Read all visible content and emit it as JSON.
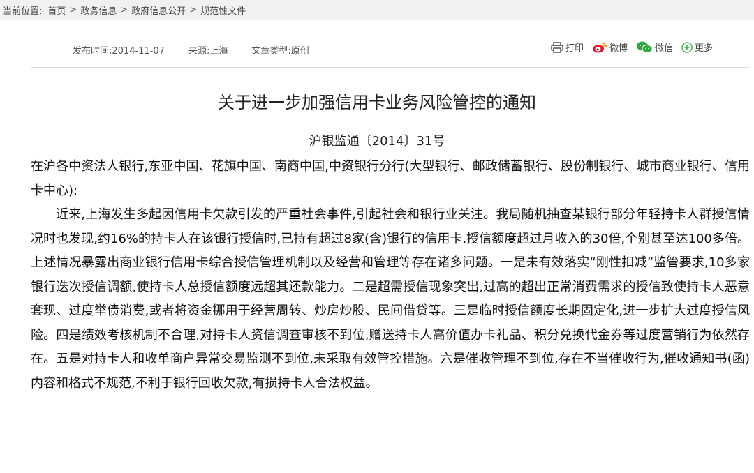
{
  "breadcrumb": {
    "label": "当前位置:",
    "items": [
      "首页",
      "政务信息",
      "政府信息公开",
      "规范性文件"
    ],
    "separator": ">"
  },
  "meta": {
    "publish_time": "发布时间:2014-11-07",
    "source": "来源:上海",
    "type": "文章类型:原创"
  },
  "share": {
    "print": "打印",
    "weibo": "微博",
    "wechat": "微信",
    "more": "更多"
  },
  "article": {
    "title": "关于进一步加强信用卡业务风险管控的通知",
    "doc_number": "沪银监通〔2014〕31号",
    "addressee": "在沪各中资法人银行,东亚中国、花旗中国、南商中国,中资银行分行(大型银行、邮政储蓄银行、股份制银行、城市商业银行、信用卡中心):",
    "paragraph1": "近来,上海发生多起因信用卡欠款引发的严重社会事件,引起社会和银行业关注。我局随机抽查某银行部分年轻持卡人群授信情况时也发现,约16%的持卡人在该银行授信时,已持有超过8家(含)银行的信用卡,授信额度超过月收入的30倍,个别甚至达100多倍。上述情况暴露出商业银行信用卡综合授信管理机制以及经营和管理等存在诸多问题。一是未有效落实“刚性扣减”监管要求,10多家银行迭次授信调额,使持卡人总授信额度远超其还款能力。二是超需授信现象突出,过高的超出正常消费需求的授信致使持卡人恶意套现、过度举债消费,或者将资金挪用于经营周转、炒房炒股、民间借贷等。三是临时授信额度长期固定化,进一步扩大过度授信风险。四是绩效考核机制不合理,对持卡人资信调查审核不到位,赠送持卡人高价值办卡礼品、积分兑换代金券等过度营销行为依然存在。五是对持卡人和收单商户异常交易监测不到位,未采取有效管控措施。六是催收管理不到位,存在不当催收行为,催收通知书(函)内容和格式不规范,不利于银行回收欠款,有损持卡人合法权益。"
  },
  "icons": {
    "print": "printer-icon",
    "weibo": "weibo-icon",
    "wechat": "wechat-icon",
    "more": "plus-circle-icon"
  },
  "colors": {
    "weibo": "#e6162d",
    "wechat": "#2ca93a",
    "more": "#35b34a"
  }
}
